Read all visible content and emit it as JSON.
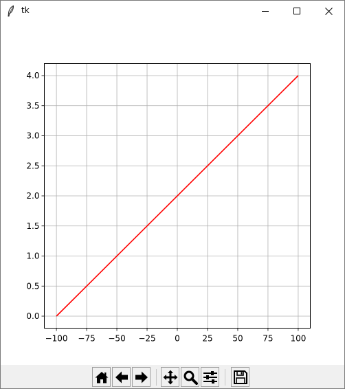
{
  "window": {
    "title": "tk"
  },
  "chart_data": {
    "type": "line",
    "title": "",
    "xlabel": "",
    "ylabel": "",
    "xlim": [
      -110,
      110
    ],
    "ylim": [
      -0.2,
      4.2
    ],
    "grid": true,
    "x_ticks": [
      -100,
      -75,
      -50,
      -25,
      0,
      25,
      50,
      75,
      100
    ],
    "x_tick_labels": [
      "−100",
      "−75",
      "−50",
      "−25",
      "0",
      "25",
      "50",
      "75",
      "100"
    ],
    "y_ticks": [
      0.0,
      0.5,
      1.0,
      1.5,
      2.0,
      2.5,
      3.0,
      3.5,
      4.0
    ],
    "y_tick_labels": [
      "0.0",
      "0.5",
      "1.0",
      "1.5",
      "2.0",
      "2.5",
      "3.0",
      "3.5",
      "4.0"
    ],
    "series": [
      {
        "color": "#ff0000",
        "x": [
          -100,
          100
        ],
        "y": [
          0.0,
          4.0
        ]
      }
    ]
  },
  "toolbar": {
    "buttons": [
      {
        "name": "home-button",
        "icon": "home-icon"
      },
      {
        "name": "back-button",
        "icon": "arrow-left-icon"
      },
      {
        "name": "forward-button",
        "icon": "arrow-right-icon"
      },
      {
        "name": "pan-button",
        "icon": "move-icon"
      },
      {
        "name": "zoom-button",
        "icon": "magnifier-icon"
      },
      {
        "name": "configure-subplots-button",
        "icon": "sliders-icon"
      },
      {
        "name": "save-button",
        "icon": "floppy-disk-icon"
      }
    ]
  }
}
